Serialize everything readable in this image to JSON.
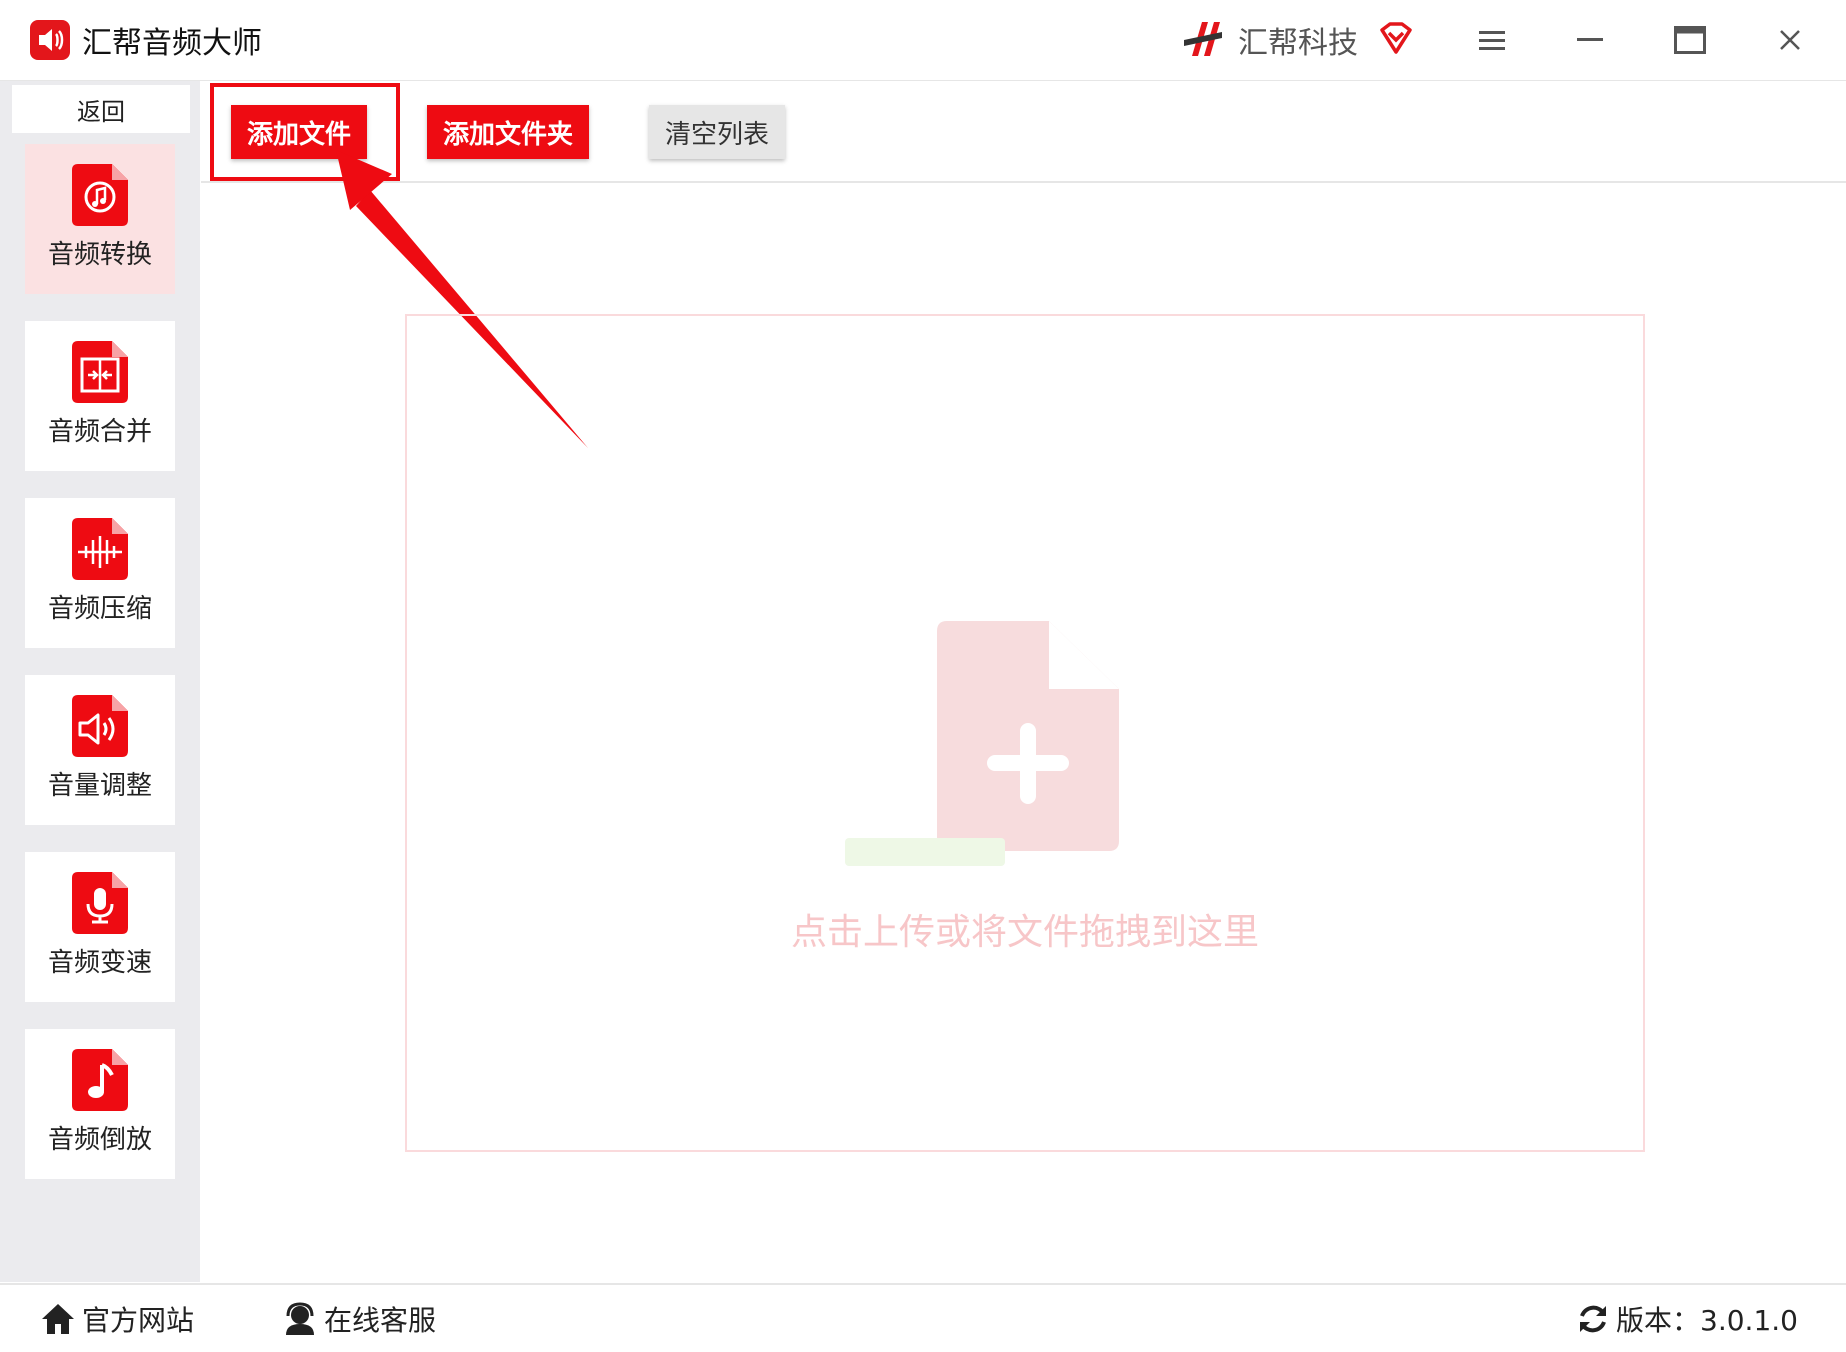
{
  "app": {
    "title": "汇帮音频大师",
    "brand": "汇帮科技"
  },
  "sidebar": {
    "back_label": "返回",
    "items": [
      {
        "label": "音频转换",
        "icon": "audio-convert-icon",
        "active": true
      },
      {
        "label": "音频合并",
        "icon": "audio-merge-icon",
        "active": false
      },
      {
        "label": "音频压缩",
        "icon": "audio-compress-icon",
        "active": false
      },
      {
        "label": "音量调整",
        "icon": "volume-adjust-icon",
        "active": false
      },
      {
        "label": "音频变速",
        "icon": "audio-speed-icon",
        "active": false
      },
      {
        "label": "音频倒放",
        "icon": "audio-reverse-icon",
        "active": false
      }
    ]
  },
  "toolbar": {
    "add_file": "添加文件",
    "add_folder": "添加文件夹",
    "clear_list": "清空列表"
  },
  "dropzone": {
    "hint": "点击上传或将文件拖拽到这里"
  },
  "footer": {
    "website": "官方网站",
    "support": "在线客服",
    "version": "版本：3.0.1.0"
  },
  "colors": {
    "accent": "#ee0b12",
    "active_bg": "#fbe1e2",
    "hint": "#f7c6c8"
  }
}
